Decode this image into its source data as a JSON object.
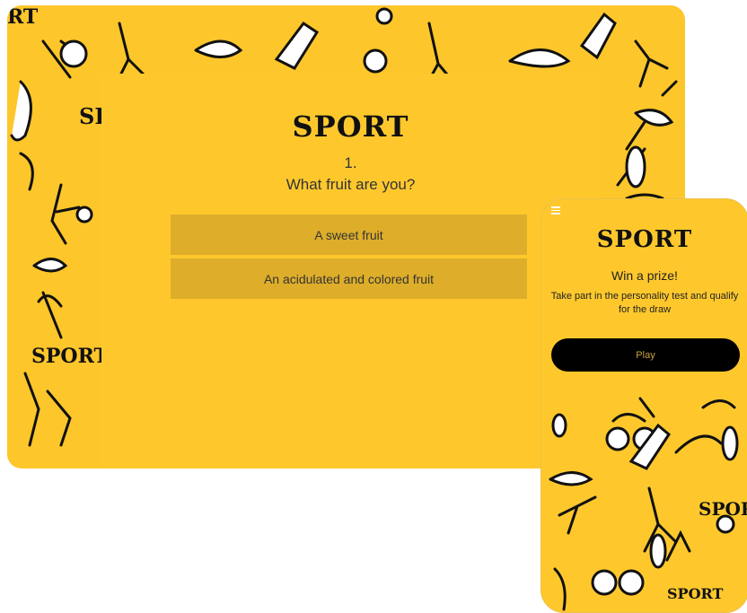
{
  "brand": {
    "logo": "SPORT"
  },
  "quiz": {
    "number": "1.",
    "question": "What fruit are you?",
    "answers": [
      "A sweet fruit",
      "An acidulated and colored fruit"
    ]
  },
  "promo": {
    "title": "Win a prize!",
    "description": "Take part in the personality test and qualify for the draw",
    "play_label": "Play"
  },
  "pattern_labels": {
    "left": "SPORT",
    "top_left": "RT",
    "left_edge": "SP",
    "phone": "SPORT",
    "phone_bottom": "SPORT"
  },
  "colors": {
    "yellow": "#FDC62B",
    "answer_bg": "#DEAE2A",
    "button": "#000000"
  }
}
